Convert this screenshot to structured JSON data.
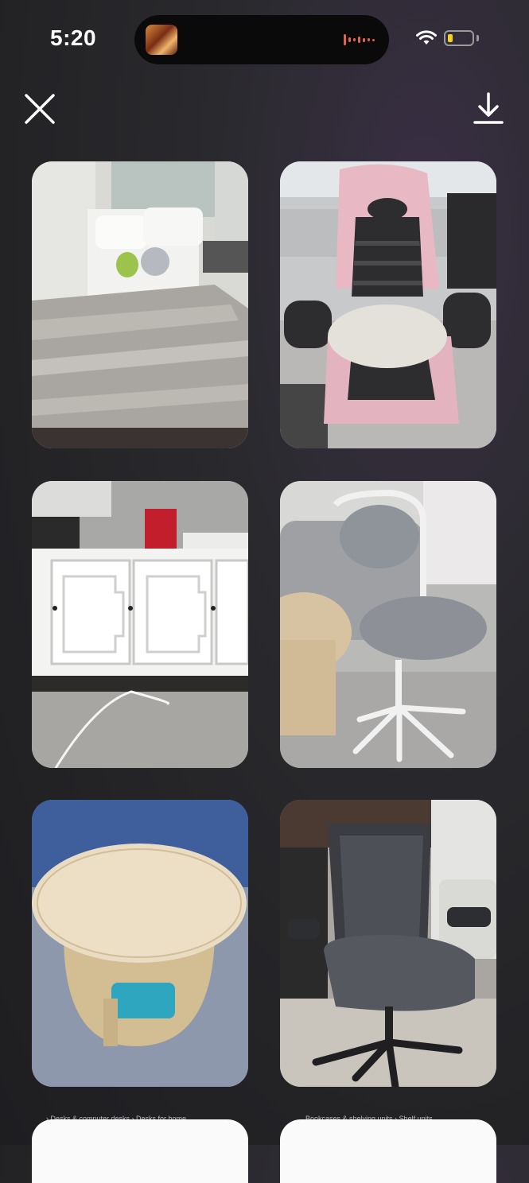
{
  "status_bar": {
    "time": "5:20",
    "battery_color": "#f2d21a",
    "wave_color": "#e0654f",
    "icons": [
      "now-playing-artwork-icon",
      "audio-waveform-icon",
      "wifi-icon",
      "battery-icon"
    ]
  },
  "toolbar": {
    "close_icon": "close-icon",
    "download_icon": "download-icon"
  },
  "gallery": {
    "items": [
      {
        "subject": "bed"
      },
      {
        "subject": "pink-gaming-chair"
      },
      {
        "subject": "white-sideboard-cabinet"
      },
      {
        "subject": "grey-swivel-chair"
      },
      {
        "subject": "round-wooden-coffee-table"
      },
      {
        "subject": "mesh-office-chair"
      }
    ],
    "partial_items": [
      {
        "caption": "› Desks & computer desks  ›  Desks for home"
      },
      {
        "caption": "Bookcases & shelving units  ›  Shelf units"
      }
    ]
  }
}
